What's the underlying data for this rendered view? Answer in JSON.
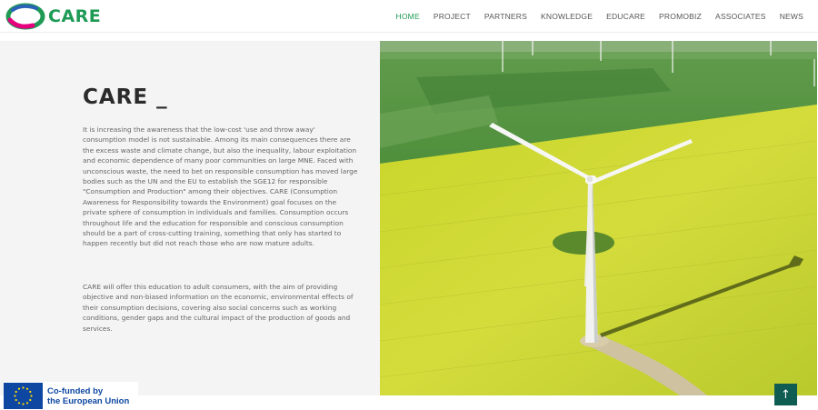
{
  "brand": {
    "name": "CARE",
    "accent": "#1f9a55"
  },
  "nav": [
    {
      "label": "HOME",
      "active": true
    },
    {
      "label": "PROJECT"
    },
    {
      "label": "PARTNERS"
    },
    {
      "label": "KNOWLEDGE"
    },
    {
      "label": "EDUCARE"
    },
    {
      "label": "PROMOBIZ"
    },
    {
      "label": "ASSOCIATES"
    },
    {
      "label": "NEWS"
    }
  ],
  "section": {
    "title": "CARE _",
    "paragraphs": [
      "It is increasing the awareness that the low-cost 'use and throw away' consumption model is not sustainable. Among its main consequences there are the excess waste and climate change, but also the inequality, labour exploitation and economic dependence of many poor communities on large MNE. Faced with unconscious waste, the need to bet on responsible consumption has moved large bodies such as the UN and the EU to establish the SGE12 for responsible \"Consumption and Production\" among their objectives. CARE (Consumption Awareness for Responsibility towards the Environment) goal focuses on the private sphere of consumption in individuals and families. Consumption occurs throughout life and the education for responsible and conscious consumption should be a part of cross-cutting training, something that only has started to happen recently but did not reach those who are now mature adults.",
      "CARE will offer this education to adult consumers, with the aim of providing objective and non-biased information on the economic, environmental effects of their consumption decisions, covering also social concerns such as working conditions, gender gaps and the cultural impact of the production of goods and services."
    ]
  },
  "image": {
    "subject": "wind-turbine-in-rapeseed-field"
  },
  "footer": {
    "eu_line1": "Co-funded by",
    "eu_line2": "the European Union",
    "eu_color": "#0e47a1"
  },
  "scroll_top": {
    "icon": "arrow-up-icon",
    "glyph": "↑",
    "color": "#0f5c52"
  }
}
